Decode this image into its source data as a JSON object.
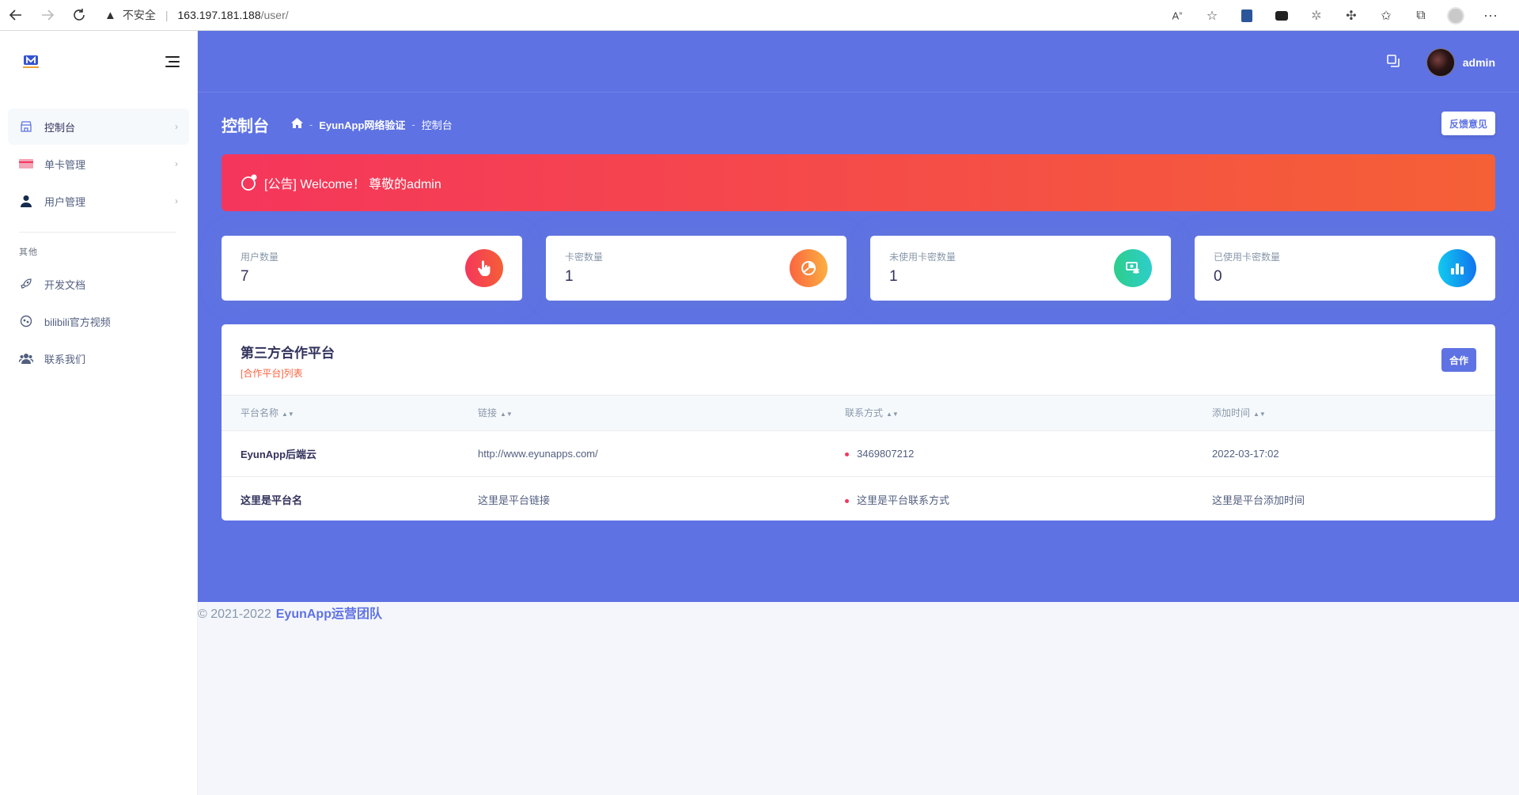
{
  "browser": {
    "insecure_label": "不安全",
    "url_host": "163.197.181.188",
    "url_path": "/user/"
  },
  "sidebar": {
    "items": [
      {
        "label": "控制台",
        "icon": "store-icon"
      },
      {
        "label": "单卡管理",
        "icon": "credit-card-icon"
      },
      {
        "label": "用户管理",
        "icon": "user-icon"
      }
    ],
    "heading": "其他",
    "other_items": [
      {
        "label": "开发文档",
        "icon": "rocket-icon"
      },
      {
        "label": "bilibili官方视频",
        "icon": "bilibili-icon"
      },
      {
        "label": "联系我们",
        "icon": "users-icon"
      }
    ]
  },
  "topbar": {
    "user_name": "admin"
  },
  "header": {
    "title": "控制台",
    "breadcrumb": [
      "EyunApp网络验证",
      "控制台"
    ],
    "feedback_label": "反馈意见"
  },
  "notice": {
    "text": "[公告] Welcome！ 尊敬的admin"
  },
  "stats": [
    {
      "label": "用户数量",
      "value": "7",
      "color": "#f5365c",
      "icon": "hand-pointer-icon"
    },
    {
      "label": "卡密数量",
      "value": "1",
      "color": "#fb6340",
      "icon": "pie-chart-icon"
    },
    {
      "label": "未使用卡密数量",
      "value": "1",
      "color": "#2dce89",
      "icon": "money-coins-icon"
    },
    {
      "label": "已使用卡密数量",
      "value": "0",
      "color": "#11cdef",
      "icon": "bar-chart-icon"
    }
  ],
  "table": {
    "title": "第三方合作平台",
    "subtitle": "[合作平台]列表",
    "button_label": "合作",
    "columns": [
      "平台名称",
      "链接",
      "联系方式",
      "添加时间"
    ],
    "rows": [
      [
        "EyunApp后端云",
        "http://www.eyunapps.com/",
        "3469807212",
        "2022-03-17:02"
      ],
      [
        "这里是平台名",
        "这里是平台链接",
        "这里是平台联系方式",
        "这里是平台添加时间"
      ]
    ]
  },
  "footer": {
    "copyright": "© 2021-2022",
    "team": "EyunApp运营团队"
  },
  "colors": {
    "primary": "#5e72e4",
    "danger": "#f5365c",
    "warning": "#fb6340",
    "success": "#2dce89",
    "info": "#11cdef"
  }
}
